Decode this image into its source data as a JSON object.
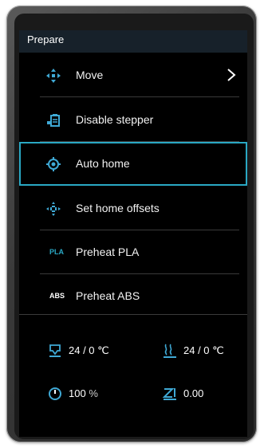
{
  "screen": {
    "title": "Prepare"
  },
  "menu": [
    {
      "label": "Move",
      "icon": "move-arrows-icon",
      "has_submenu": true
    },
    {
      "label": "Disable stepper",
      "icon": "disable-stepper-icon",
      "has_submenu": false
    },
    {
      "label": "Auto home",
      "icon": "auto-home-target-icon",
      "has_submenu": false,
      "selected": true
    },
    {
      "label": "Set home offsets",
      "icon": "set-home-offsets-icon",
      "has_submenu": false
    },
    {
      "label": "Preheat PLA",
      "icon_text": "PLA",
      "icon_color": "#2aa8c4"
    },
    {
      "label": "Preheat ABS",
      "icon_text": "ABS",
      "icon_color": "#ffffff"
    }
  ],
  "status": {
    "nozzle_temp": "24 / 0 ℃",
    "bed_temp": "24 / 0 ℃",
    "speed_value": "100",
    "speed_unit": "%",
    "z_offset": "0.00"
  },
  "colors": {
    "accent": "#2aa8c4",
    "header_bg": "#17212a",
    "icon_accent": "#3fa9d5"
  }
}
